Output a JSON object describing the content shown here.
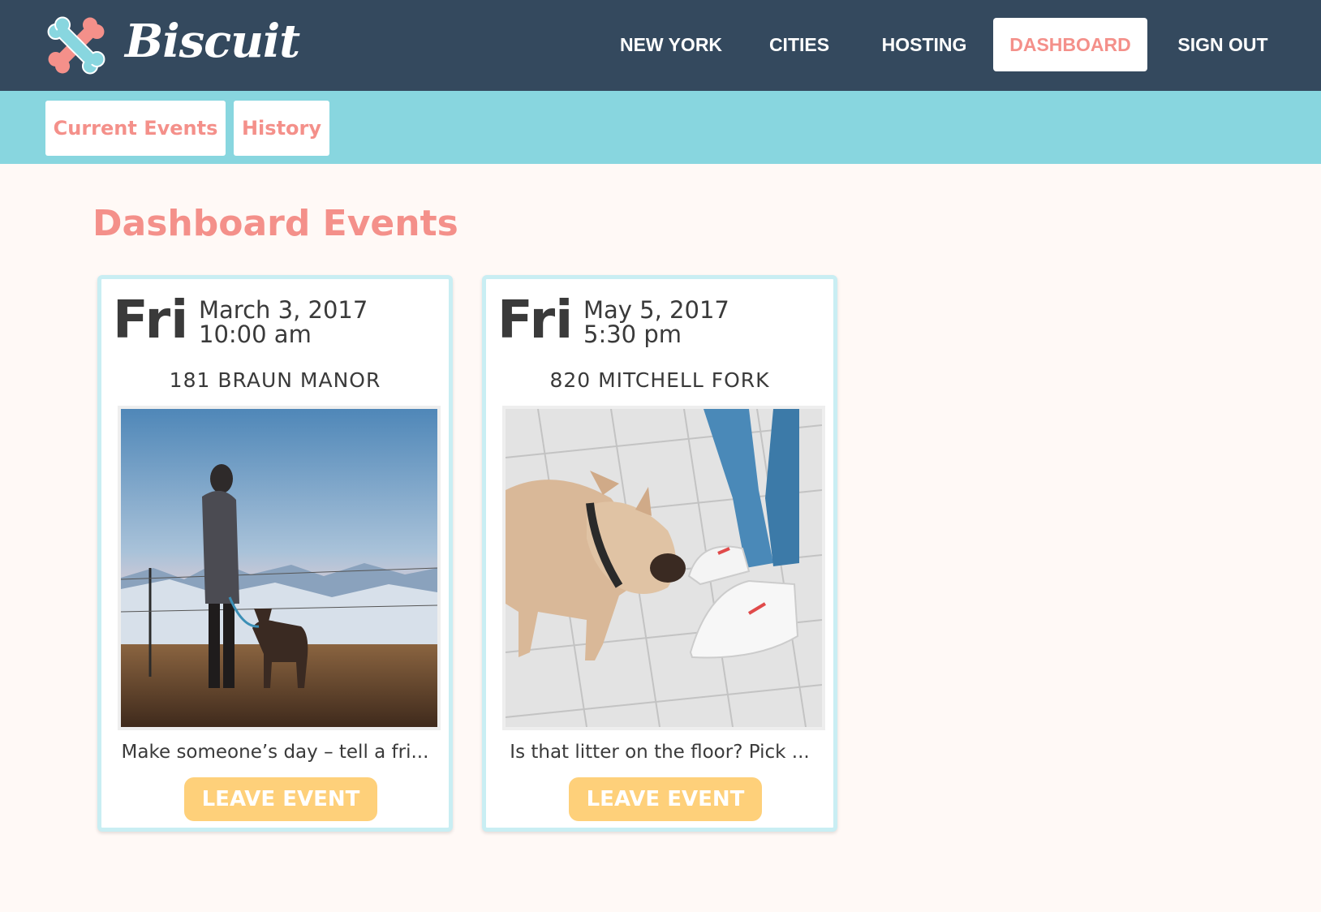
{
  "header": {
    "brand": "Biscuit",
    "logo_icon": "bone-cross-icon",
    "nav": [
      {
        "label": "NEW YORK"
      },
      {
        "label": "CITIES"
      },
      {
        "label": "HOSTING"
      },
      {
        "label": "DASHBOARD",
        "active": true
      },
      {
        "label": "SIGN OUT"
      }
    ]
  },
  "subnav": {
    "tabs": [
      {
        "label": "Current Events"
      },
      {
        "label": "History"
      }
    ]
  },
  "main": {
    "title": "Dashboard Events",
    "events": [
      {
        "day": "Fri",
        "date": "March 3, 2017",
        "time": "10:00 am",
        "address": "181 BRAUN MANOR",
        "photo": "woman-with-dog-at-sunset-photo",
        "description": "Make someone’s day – tell a fri...",
        "button": "LEAVE EVENT"
      },
      {
        "day": "Fri",
        "date": "May 5, 2017",
        "time": "5:30 pm",
        "address": "820 MITCHELL FORK",
        "photo": "french-bulldog-sniffing-sneakers-photo",
        "description": "Is that litter on the floor? Pick ...",
        "button": "LEAVE EVENT"
      }
    ]
  },
  "colors": {
    "navbar": "#34495e",
    "subnav": "#88d6df",
    "accent": "#f4908a",
    "button": "#fed07a",
    "background": "#fff9f6",
    "card_border": "#c9eef3"
  }
}
